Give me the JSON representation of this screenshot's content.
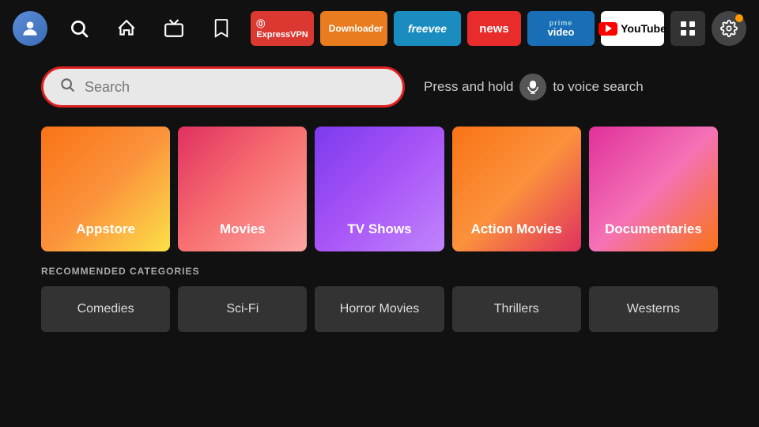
{
  "nav": {
    "apps": [
      {
        "id": "expressvpn",
        "label": "ExpressVPN",
        "class": "badge-expressvpn"
      },
      {
        "id": "downloader",
        "label": "Downloader",
        "class": "badge-downloader"
      },
      {
        "id": "freevee",
        "label": "freevee",
        "class": "badge-freevee"
      },
      {
        "id": "news",
        "label": "news",
        "class": "badge-news"
      },
      {
        "id": "prime",
        "label": "prime video",
        "class": "badge-prime"
      },
      {
        "id": "youtube",
        "label": "YouTube",
        "class": "badge-youtube"
      }
    ],
    "settings_label": "Settings"
  },
  "search": {
    "placeholder": "Search",
    "voice_hint_prefix": "Press and hold",
    "voice_hint_suffix": "to voice search"
  },
  "categories": [
    {
      "id": "appstore",
      "label": "Appstore",
      "class": "cat-appstore"
    },
    {
      "id": "movies",
      "label": "Movies",
      "class": "cat-movies"
    },
    {
      "id": "tvshows",
      "label": "TV Shows",
      "class": "cat-tvshows"
    },
    {
      "id": "action",
      "label": "Action Movies",
      "class": "cat-action"
    },
    {
      "id": "documentaries",
      "label": "Documentaries",
      "class": "cat-documentaries"
    }
  ],
  "recommended": {
    "title": "RECOMMENDED CATEGORIES",
    "items": [
      {
        "id": "comedies",
        "label": "Comedies"
      },
      {
        "id": "scifi",
        "label": "Sci-Fi"
      },
      {
        "id": "horror",
        "label": "Horror Movies"
      },
      {
        "id": "thrillers",
        "label": "Thrillers"
      },
      {
        "id": "westerns",
        "label": "Westerns"
      }
    ]
  }
}
